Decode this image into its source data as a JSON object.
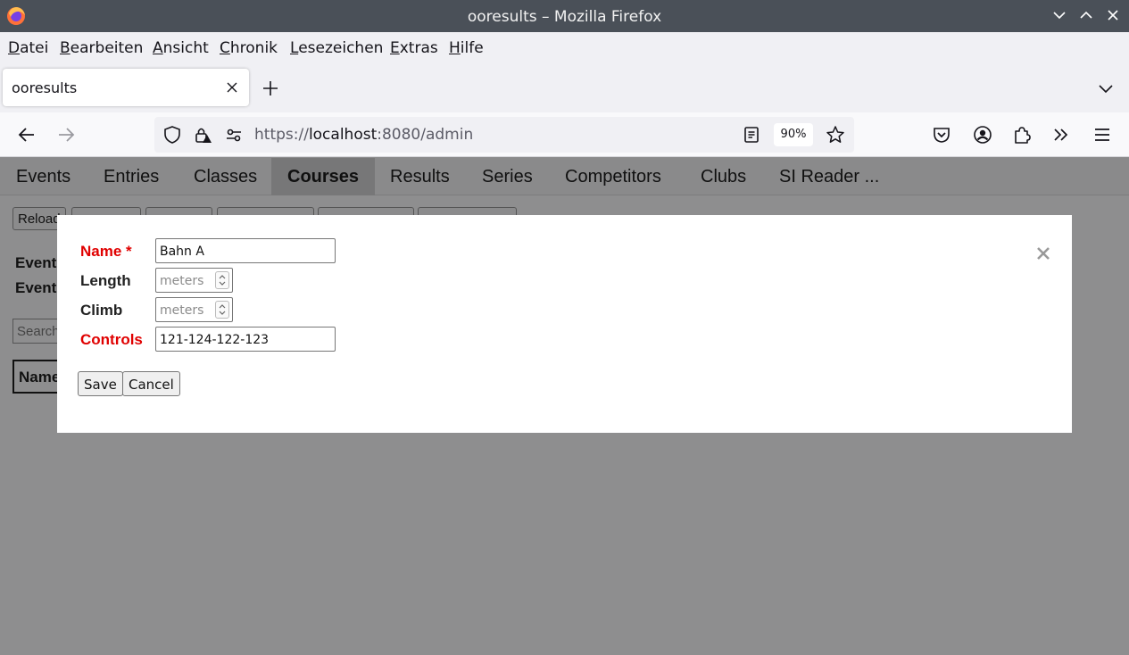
{
  "window": {
    "title": "ooresults – Mozilla Firefox"
  },
  "menu": [
    "Datei",
    "Bearbeiten",
    "Ansicht",
    "Chronik",
    "Lesezeichen",
    "Extras",
    "Hilfe"
  ],
  "tab": {
    "title": "ooresults"
  },
  "address": {
    "scheme": "https://",
    "host": "localhost",
    "rest": ":8080/admin",
    "zoom": "90%"
  },
  "app_tabs": [
    "Events",
    "Entries",
    "Classes",
    "Courses",
    "Results",
    "Series",
    "Competitors",
    "Clubs",
    "SI Reader ..."
  ],
  "app_tab_active": "Courses",
  "toolbar": {
    "reload_label": "Reload"
  },
  "event_labels": [
    "Event",
    "Event"
  ],
  "search": {
    "placeholder": "Search"
  },
  "table": {
    "col_name": "Name"
  },
  "modal": {
    "name_label": "Name *",
    "name_value": "Bahn A",
    "length_label": "Length",
    "length_placeholder": "meters",
    "climb_label": "Climb",
    "climb_placeholder": "meters",
    "controls_label": "Controls",
    "controls_value": "121-124-122-123",
    "save_label": "Save",
    "cancel_label": "Cancel"
  },
  "colors": {
    "required_label": "#e00000",
    "titlebar": "#4a5058",
    "overlay": "#8e8e8f"
  }
}
